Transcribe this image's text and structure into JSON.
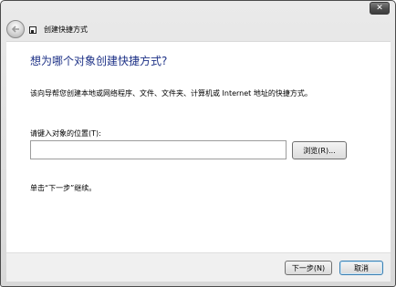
{
  "titlebar": {
    "close_glyph": "✕"
  },
  "nav": {
    "back_glyph": "←",
    "title": "创建快捷方式",
    "icon": "wizard-icon"
  },
  "main": {
    "heading": "想为哪个对象创建快捷方式?",
    "description": "该向导帮您创建本地或网络程序、文件、文件夹、计算机或 Internet 地址的快捷方式。",
    "location_label": "请键入对象的位置(T):",
    "location_value": "",
    "browse_label": "浏览(R)...",
    "hint": "单击“下一步”继续。"
  },
  "footer": {
    "next_label": "下一步(N)",
    "cancel_label": "取消"
  },
  "colors": {
    "heading": "#1e3287",
    "focus_border": "#3c7fb1"
  }
}
